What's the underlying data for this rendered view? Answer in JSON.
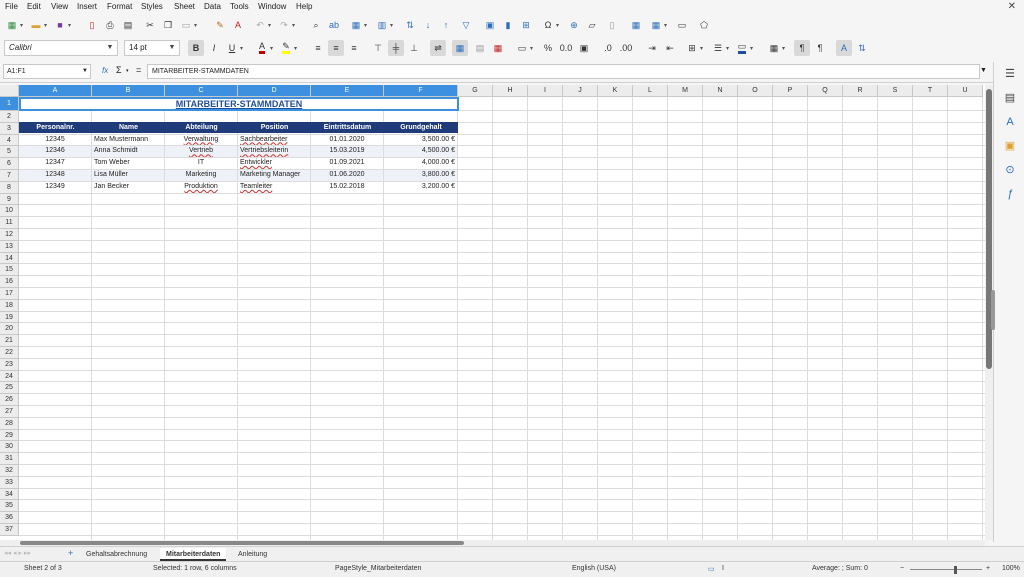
{
  "menu": [
    "File",
    "Edit",
    "View",
    "Insert",
    "Format",
    "Styles",
    "Sheet",
    "Data",
    "Tools",
    "Window",
    "Help"
  ],
  "toolbar": {
    "font_name": "Calibri",
    "font_size": "14 pt",
    "font_color": "#c00000",
    "highlight_color": "#ffff00",
    "border_color": "#1f4e9b"
  },
  "formula_bar": {
    "name_box": "A1:F1",
    "fx_label": "fx",
    "sigma_label": "Σ",
    "equals_label": "=",
    "content": "MITARBEITER-STAMMDATEN"
  },
  "grid": {
    "columns": [
      "A",
      "B",
      "C",
      "D",
      "E",
      "F",
      "G",
      "H",
      "I",
      "J",
      "K",
      "L",
      "M",
      "N",
      "O",
      "P",
      "Q",
      "R",
      "S",
      "T",
      "U"
    ],
    "selected_columns": [
      "A",
      "B",
      "C",
      "D",
      "E",
      "F"
    ],
    "row_count": 37,
    "selected_row": 1,
    "title": "MITARBEITER-STAMMDATEN",
    "header_color": "#1f3b7a",
    "title_color": "#1f4e9b",
    "headers": [
      "Personalnr.",
      "Name",
      "Abteilung",
      "Position",
      "Eintrittsdatum",
      "Grundgehalt"
    ],
    "rows": [
      [
        "12345",
        "Max Mustermann",
        "Verwaltung",
        "Sachbearbeiter",
        "01.01.2020",
        "3,500.00 €"
      ],
      [
        "12346",
        "Anna Schmidt",
        "Vertrieb",
        "Vertriebsleiterin",
        "15.03.2019",
        "4,500.00 €"
      ],
      [
        "12347",
        "Tom Weber",
        "IT",
        "Entwickler",
        "01.09.2021",
        "4,000.00 €"
      ],
      [
        "12348",
        "Lisa Müller",
        "Marketing",
        "Marketing Manager",
        "01.06.2020",
        "3,800.00 €"
      ],
      [
        "12349",
        "Jan Becker",
        "Produktion",
        "Teamleiter",
        "15.02.2018",
        "3,200.00 €"
      ]
    ]
  },
  "sheet_tabs": {
    "add_label": "+",
    "tabs": [
      "Gehaltsabrechnung",
      "Mitarbeiterdaten",
      "Anleitung"
    ],
    "active": "Mitarbeiterdaten"
  },
  "status": {
    "sheet": "Sheet 2 of 3",
    "selection": "Selected: 1 row, 6 columns",
    "page_style": "PageStyle_Mitarbeiterdaten",
    "language": "English (USA)",
    "summary": "Average: ; Sum: 0",
    "zoom": "100%"
  }
}
